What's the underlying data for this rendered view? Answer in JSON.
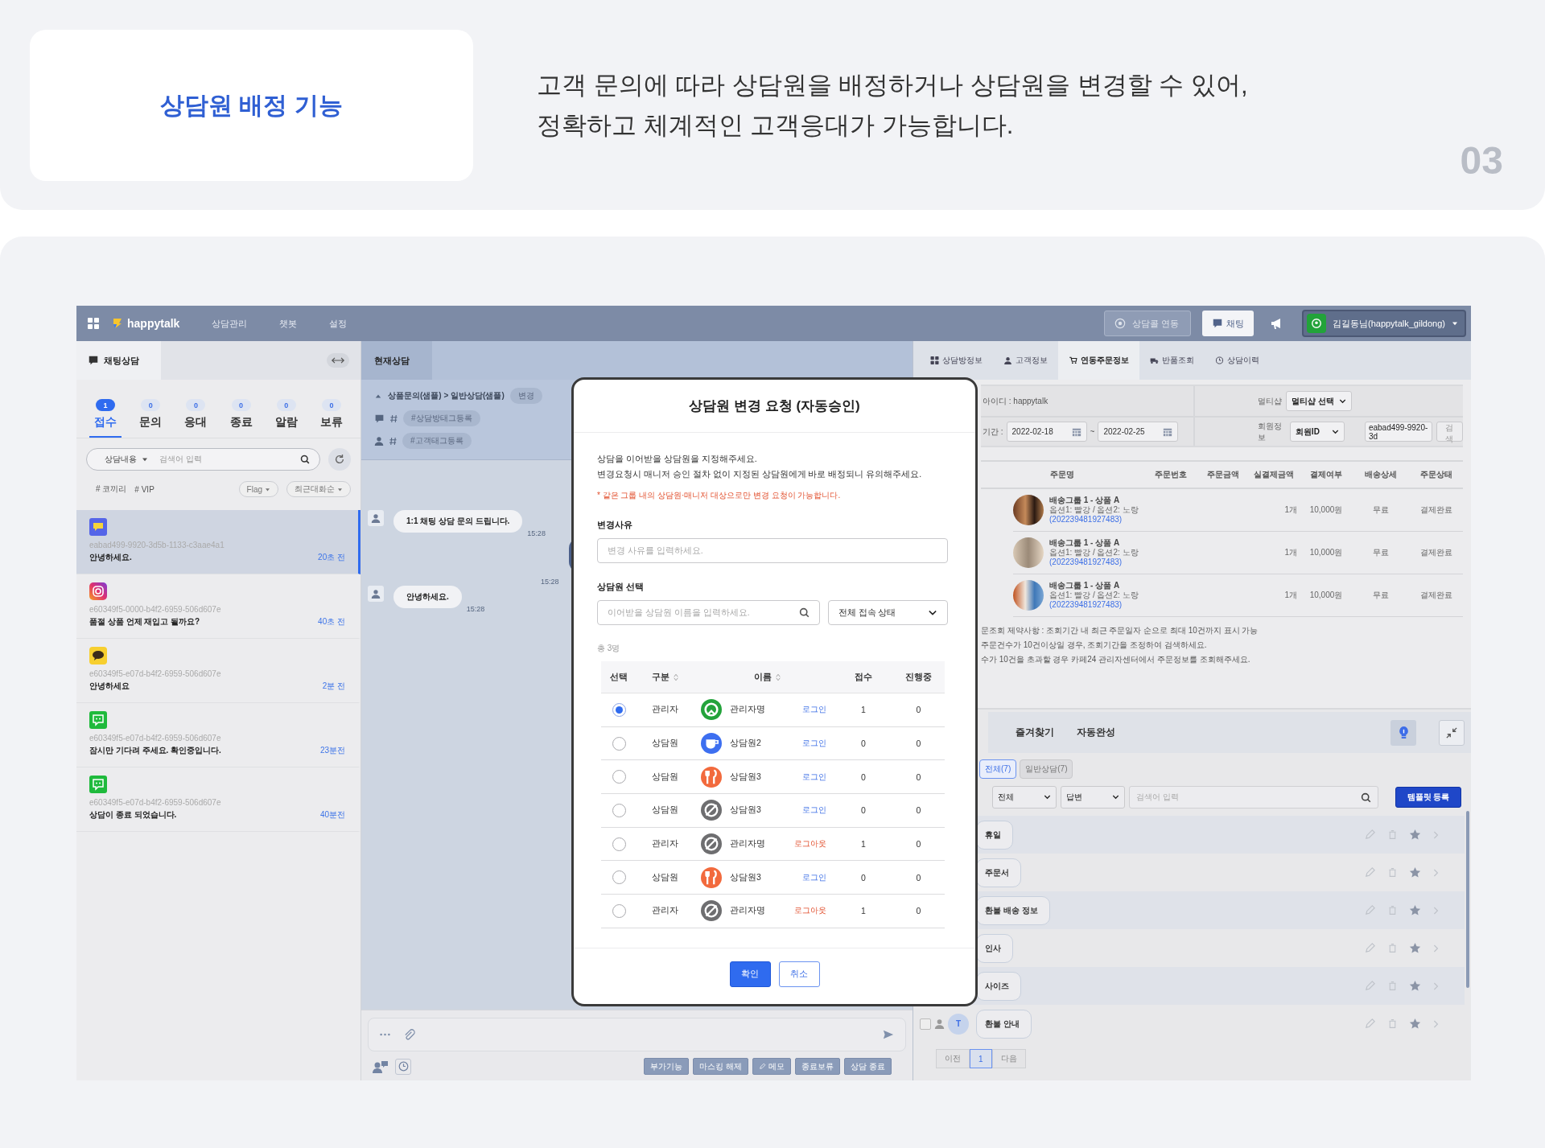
{
  "feature": {
    "title": "상담원 배정 기능",
    "description": [
      "고객 문의에 따라 상담원을 배정하거나 상담원을 변경할 수 있어,",
      "정확하고 체계적인 고객응대가 가능합니다."
    ],
    "number": "03"
  },
  "topbar": {
    "brand": "happytalk",
    "menu": [
      "상담관리",
      "챗봇",
      "설정"
    ],
    "call_button": "상담콜 연동",
    "chat_button": "채팅",
    "user": "김길동님(happytalk_gildong)"
  },
  "chat_list": {
    "title": "채팅상담",
    "status_tabs": [
      {
        "label": "접수",
        "count": "1",
        "selected": true
      },
      {
        "label": "문의",
        "count": "0",
        "selected": false
      },
      {
        "label": "응대",
        "count": "0",
        "selected": false
      },
      {
        "label": "종료",
        "count": "0",
        "selected": false
      },
      {
        "label": "알람",
        "count": "0",
        "selected": false
      },
      {
        "label": "보류",
        "count": "0",
        "selected": false
      }
    ],
    "search": {
      "scope": "상담내용",
      "placeholder": "검색어 입력"
    },
    "tags": [
      "# 코끼리",
      "# VIP"
    ],
    "filters": [
      "Flag",
      "최근대화순"
    ],
    "chats": [
      {
        "kind": "happytalk",
        "id": "eabad499-9920-3d5b-1133-c3aae4a1",
        "message": "안녕하세요.",
        "time": "20초 전",
        "selected": true
      },
      {
        "kind": "instagram",
        "id": "e60349f5-0000-b4f2-6959-506d607e",
        "message": "품절 상품 언제 재입고 될까요?",
        "time": "40초 전",
        "selected": false
      },
      {
        "kind": "kakao",
        "id": "e60349f5-e07d-b4f2-6959-506d607e",
        "message": "안녕하세요",
        "time": "2분 전",
        "selected": false
      },
      {
        "kind": "sms",
        "id": "e60349f5-e07d-b4f2-6959-506d607e",
        "message": "잠시만 기다려 주세요. 확인중입니다.",
        "time": "23분전",
        "selected": false
      },
      {
        "kind": "sms",
        "id": "e60349f5-e07d-b4f2-6959-506d607e",
        "message": "상담이 종료 되었습니다.",
        "time": "40분전",
        "selected": false
      }
    ]
  },
  "chat_room": {
    "title": "현재상담",
    "breadcrumb": "상품문의(샘플) > 일반상담(샘플)",
    "change_button": "변경",
    "room_tag": "#상담방태그등록",
    "customer_tag": "#고객태그등록",
    "messages": [
      {
        "kind": "customer",
        "text": "1:1 채팅 상담 문의 드립니다.",
        "time": "15:28"
      },
      {
        "kind": "agent",
        "time": "15:28"
      },
      {
        "kind": "customer",
        "text": "안녕하세요.",
        "time": "15:28"
      }
    ],
    "actions": [
      "부가기능",
      "마스킹 해제",
      "메모",
      "종료보류",
      "상담 종료"
    ]
  },
  "info_panel": {
    "tabs": [
      {
        "label": "상담방정보",
        "selected": false
      },
      {
        "label": "고객정보",
        "selected": false
      },
      {
        "label": "연동주문정보",
        "selected": true
      },
      {
        "label": "반품조회",
        "selected": false
      },
      {
        "label": "상담이력",
        "selected": false
      }
    ],
    "order_search": {
      "member_id": "아이디 : happytalk",
      "mall_label": "멀티샵",
      "mall_select": "멀티샵 선택",
      "period_label": "기간 :",
      "date_from": "2022-02-18",
      "range_separator": "~",
      "date_to": "2022-02-25",
      "member_label": "회원정보",
      "member_select": "회원ID",
      "member_value": "eabad499-9920-3d",
      "search_button": "검색"
    },
    "order_columns": [
      "주문명",
      "주문번호",
      "주문금액",
      "실결제금액",
      "결제여부",
      "배송상세",
      "주문상태"
    ],
    "orders": [
      {
        "name": "배송그룹 1 - 상품 A",
        "options": "옵션1: 빨강 / 옵션2: 노랑",
        "order_ref": "(202239481927483)",
        "quantity": "1개",
        "amount": "10,000원",
        "shipping": "무료",
        "status": "결제완료"
      },
      {
        "name": "배송그룹 1 - 상품 A",
        "options": "옵션1: 빨강 / 옵션2: 노랑",
        "order_ref": "(202239481927483)",
        "quantity": "1개",
        "amount": "10,000원",
        "shipping": "무료",
        "status": "결제완료"
      },
      {
        "name": "배송그룹 1 - 상품 A",
        "options": "옵션1: 빨강 / 옵션2: 노랑",
        "order_ref": "(202239481927483)",
        "quantity": "1개",
        "amount": "10,000원",
        "shipping": "무료",
        "status": "결제완료"
      }
    ],
    "notes": [
      "문조회 제약사항 : 조회기간 내 최근 주문일자 순으로 최대 10건까지 표시 가능",
      "주문건수가 10건이상일 경우, 조회기간을 조정하여 검색하세요.",
      "수가 10건을 초과할 경우 카페24 관리자센터에서 주문정보를 조회해주세요."
    ],
    "template_tabs": [
      "즐겨찾기",
      "자동완성"
    ],
    "template_filters": [
      {
        "label": "전체(7)",
        "selected": true
      },
      {
        "label": "일반상담(7)",
        "selected": false
      }
    ],
    "category_select": "전체",
    "type_select": "답변",
    "search_placeholder": "검색어 입력",
    "register_button": "템플릿 등록",
    "templates": [
      {
        "title": "휴일"
      },
      {
        "title": "주문서"
      },
      {
        "title": "환불 배송 정보"
      },
      {
        "title": "인사"
      },
      {
        "title": "사이즈"
      },
      {
        "title": "환불 안내",
        "badge": "T",
        "checked": false
      }
    ],
    "pagination": {
      "prev": "이전",
      "pages": [
        {
          "label": "1",
          "selected": true
        }
      ],
      "next": "다음"
    }
  },
  "modal": {
    "title": "상담원 변경 요청 (자동승인)",
    "intro": [
      "상담을 이어받을 상담원을 지정해주세요.",
      "변경요청시 매니저 승인 절차 없이 지정된 상담원에게 바로 배정되니 유의해주세요."
    ],
    "warning": "* 같은 그룹 내의 상담원·매니저 대상으로만 변경 요청이 가능합니다.",
    "reason_label": "변경사유",
    "reason_placeholder": "변경 사유를 입력하세요.",
    "agent_label": "상담원 선택",
    "agent_placeholder": "이어받을 상담원 이름을 입력하세요.",
    "status_select": "전체 접속 상태",
    "total": "총 3명",
    "columns": [
      "선택",
      "구분",
      "이름",
      "접수",
      "진행중"
    ],
    "agents": [
      {
        "role": "관리자",
        "kind": "headset",
        "name": "관리자명",
        "status": "로그인",
        "online": true,
        "received": "1",
        "ongoing": "0",
        "selected": true
      },
      {
        "role": "상담원",
        "kind": "cup",
        "name": "상담원2",
        "status": "로그인",
        "online": true,
        "received": "0",
        "ongoing": "0",
        "selected": false
      },
      {
        "role": "상담원",
        "kind": "cutlery",
        "name": "상담원3",
        "status": "로그인",
        "online": true,
        "received": "0",
        "ongoing": "0",
        "selected": false
      },
      {
        "role": "상담원",
        "kind": "offline",
        "name": "상담원3",
        "status": "로그인",
        "online": true,
        "received": "0",
        "ongoing": "0",
        "selected": false
      },
      {
        "role": "관리자",
        "kind": "offline",
        "name": "관리자명",
        "status": "로그아웃",
        "online": false,
        "received": "1",
        "ongoing": "0",
        "selected": false
      },
      {
        "role": "상담원",
        "kind": "cutlery",
        "name": "상담원3",
        "status": "로그인",
        "online": true,
        "received": "0",
        "ongoing": "0",
        "selected": false
      },
      {
        "role": "관리자",
        "kind": "offline",
        "name": "관리자명",
        "status": "로그아웃",
        "online": false,
        "received": "1",
        "ongoing": "0",
        "selected": false
      }
    ],
    "confirm_button": "확인",
    "cancel_button": "취소"
  }
}
